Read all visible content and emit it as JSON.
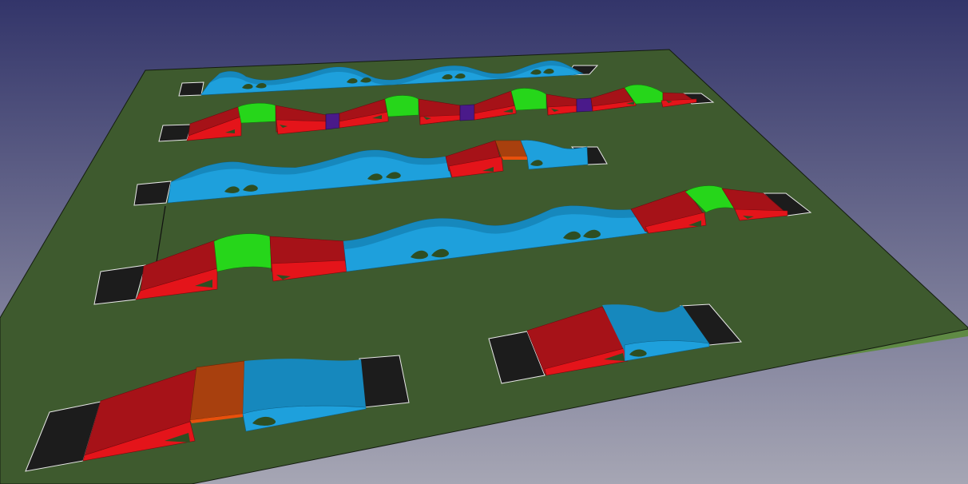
{
  "scene": {
    "background": {
      "top": "#33356a",
      "bottom": "#a6a6b4"
    },
    "ground": {
      "fill": "#3e5a2e",
      "edge": "#5f8a44",
      "outline": "#141c10"
    },
    "colors": {
      "blue": "#1ea0dc",
      "blue_dark": "#1688bd",
      "red": "#e4141a",
      "red_top": "#a61218",
      "green": "#26d61a",
      "orange": "#e8500c",
      "orange_top": "#a8400e",
      "purple": "#4a1a8a",
      "pad": "#1c1c1c",
      "hole": "#2e4e22",
      "rim": "#e8e8e8"
    },
    "tracks": [
      {
        "id": "row-1",
        "color_sequence": [
          "pad",
          "blue",
          "blue",
          "blue",
          "blue",
          "blue",
          "pad"
        ]
      },
      {
        "id": "row-2",
        "color_sequence": [
          "pad",
          "red",
          "green",
          "red",
          "purple",
          "red",
          "green",
          "red",
          "purple",
          "red",
          "green",
          "red",
          "purple",
          "red",
          "green",
          "red",
          "pad"
        ]
      },
      {
        "id": "row-3",
        "color_sequence": [
          "pad",
          "blue",
          "blue",
          "blue",
          "red",
          "orange",
          "blue",
          "pad"
        ]
      },
      {
        "id": "row-4",
        "color_sequence": [
          "pad",
          "red",
          "green",
          "red",
          "blue",
          "blue",
          "red",
          "green",
          "red",
          "pad"
        ]
      },
      {
        "id": "track-bottom-left",
        "color_sequence": [
          "pad",
          "red",
          "orange",
          "blue",
          "pad"
        ]
      },
      {
        "id": "track-bottom-right",
        "color_sequence": [
          "pad",
          "red",
          "blue",
          "pad"
        ]
      }
    ]
  }
}
